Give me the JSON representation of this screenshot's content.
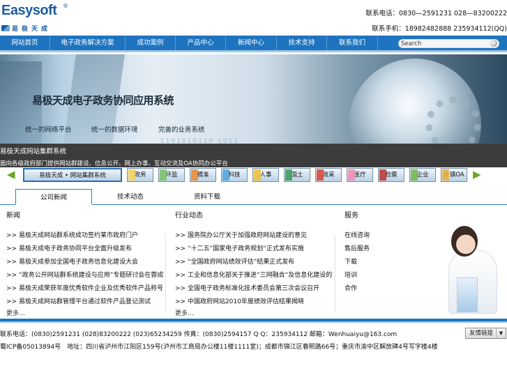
{
  "header": {
    "logo_en": "Easysoft",
    "logo_reg": "®",
    "logo_cn": "易极天成",
    "contact_line1": "联系电话：0830—2591231 028—83200222",
    "contact_line2": "联系手机：18982482888   235934112(QQ)"
  },
  "nav": {
    "items": [
      {
        "label": "网站首页"
      },
      {
        "label": "电子政务解决方案"
      },
      {
        "label": "成功案例"
      },
      {
        "label": "产品中心"
      },
      {
        "label": "新闻中心"
      },
      {
        "label": "技术支持"
      },
      {
        "label": "联系我们"
      }
    ],
    "search_value": "Search"
  },
  "banner": {
    "title": "易极天成电子政务协同应用系统",
    "subs": [
      "统一的网络平台",
      "统一的数据环境",
      "完善的业务系统"
    ],
    "binary": "1101010110  1011"
  },
  "notice": {
    "title": "易极天成网站集群系统",
    "text": "面向各级政府部门提供网站群建设、信息公开、网上办事、互动交流及OA协同办公平台"
  },
  "carousel": {
    "chips": [
      {
        "label": "易极天成 • 网站集群系统",
        "swatch": "#d9e7f3"
      },
      {
        "label": "政务",
        "swatch": "#f4d35e"
      },
      {
        "label": "环监",
        "swatch": "#7cc36b"
      },
      {
        "label": "精准",
        "swatch": "#e98b3a"
      },
      {
        "label": "科技",
        "swatch": "#58a4dd"
      },
      {
        "label": "人事",
        "swatch": "#f0c040"
      },
      {
        "label": "国土",
        "swatch": "#3fa05b"
      },
      {
        "label": "政采",
        "swatch": "#d94a3d"
      },
      {
        "label": "医疗",
        "swatch": "#f08fb0"
      },
      {
        "label": "检察",
        "swatch": "#c23a3a"
      },
      {
        "label": "企业",
        "swatch": "#79b84c"
      },
      {
        "label": "乡镇OA",
        "swatch": "#e5b04a"
      }
    ],
    "prev": "◀",
    "next": "▶"
  },
  "tabs": [
    {
      "label": "公司新闻"
    },
    {
      "label": "技术动态"
    },
    {
      "label": "资料下载"
    }
  ],
  "columns": {
    "news": {
      "heading": "新闻",
      "items": [
        ">> 易极天成网站群系统成功签约某市政府门户",
        ">> 易极天成电子政务协同平台全面升级发布",
        ">> 易极天成参加全国电子政务信息化建设大会",
        ">> “政务公开网站群系统建设与应用”专题研讨会在蓉成功举行",
        ">> 易极天成荣获年度优秀软件企业及优秀软件产品称号",
        ">> 易极天成网站群管理平台通过软件产品登记测试"
      ],
      "more": "更多…"
    },
    "industry": {
      "heading": "行业动态",
      "items": [
        ">> 国务院办公厅关于加强政府网站建设的意见",
        ">> “十二五”国家电子政务规划“正式发布实施",
        ">> “全国政府网站绩效评估”结果正式发布",
        ">> 工业和信息化部关于推进“三网融合“及信息化建设的通知”相关",
        ">> 全国电子政务标准化技术委员会第三次会议召开",
        ">> 中国政府网站2010年度绩效评估结果揭晓"
      ],
      "more": "更多…"
    },
    "service": {
      "heading": "服务",
      "items": [
        "在线咨询",
        "售后服务",
        "下载",
        "培训",
        "合作"
      ]
    }
  },
  "footer": {
    "line1": "联系电话：(0830)2591231 (028)83200222 (023)65234259 传真：(0830)2594157 Q Q：235934112 邮箱：Wenhuaiyu@163.com",
    "line2": "蜀ICP备05013894号　地址：四川省泸州市江阳区159号(泸州市工商局办公楼11楼1111室)；成都市锦江区春熙路66号；重庆市渝中区解放碑4号写字楼4楼",
    "select_label": "友情链接"
  }
}
